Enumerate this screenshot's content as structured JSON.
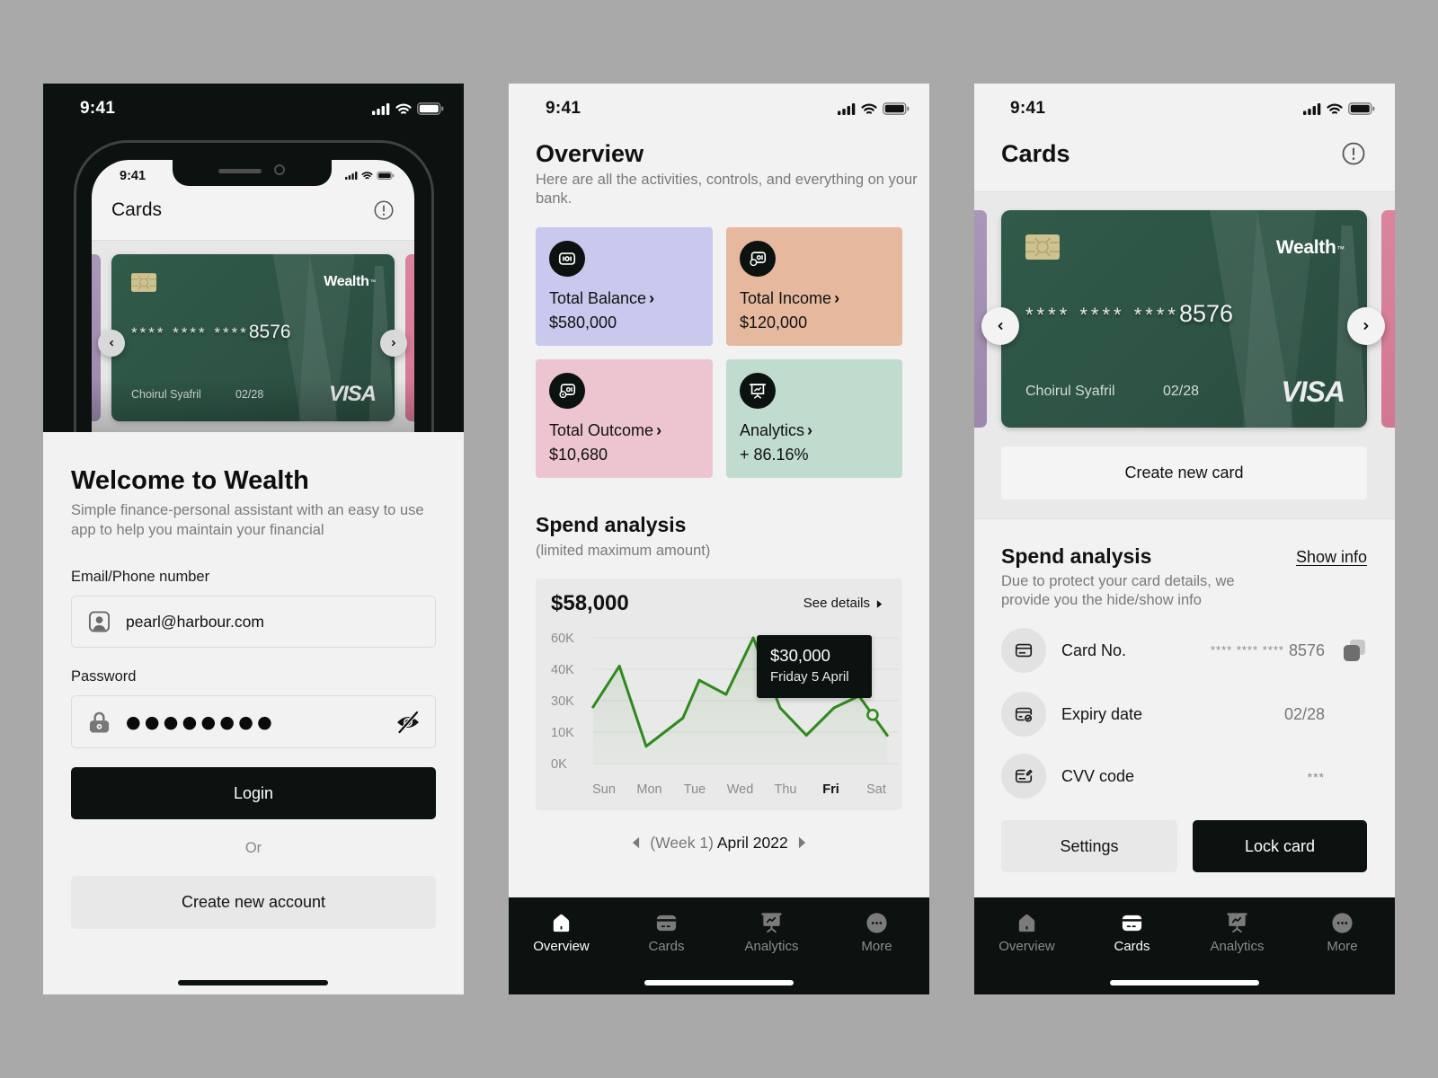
{
  "page": {
    "background": "#a9a9a9"
  },
  "theme": {
    "dark": "#0b120f",
    "card_green": "#2f5646",
    "chart_line": "#2f8a1c"
  },
  "login_screen": {
    "status_bar": {
      "time": "9:41"
    },
    "mockup": {
      "status_time": "9:41",
      "title": "Cards",
      "card": {
        "brand": "Wealth",
        "trademark": "™",
        "number_mask": "**** **** ****",
        "last4": "8576",
        "holder": "Choirul Syafril",
        "expiry": "02/28",
        "network": "VISA"
      }
    },
    "title": "Welcome to Wealth",
    "subtitle": "Simple finance-personal assistant with an easy to use app to help you maintain your financial",
    "email": {
      "label": "Email/Phone number",
      "value": "pearl@harbour.com"
    },
    "password": {
      "label": "Password",
      "masked_value": "●●●●●●●●"
    },
    "login_button": "Login",
    "divider_text": "Or",
    "create_account_button": "Create new account"
  },
  "overview_screen": {
    "status_bar": {
      "time": "9:41"
    },
    "title": "Overview",
    "subtitle": "Here are all the activities, controls, and everything on your bank.",
    "stat_chevron": "›",
    "stats": [
      {
        "label": "Total Balance",
        "value": "$580,000",
        "color": "#c9c8ee",
        "icon": "cash-icon"
      },
      {
        "label": "Total Income",
        "value": "$120,000",
        "color": "#e6b99f",
        "icon": "income-icon"
      },
      {
        "label": "Total Outcome",
        "value": "$10,680",
        "color": "#edc5d0",
        "icon": "outcome-icon"
      },
      {
        "label": "Analytics",
        "value": "+ 86.16%",
        "color": "#bfdccf",
        "icon": "presentation-chart-icon"
      }
    ],
    "spend": {
      "title": "Spend analysis",
      "subtitle": "(limited maximum amount)"
    },
    "week_selector": {
      "prefix": "(Week 1)",
      "label": "April 2022"
    },
    "bottom_nav": [
      {
        "label": "Overview",
        "active": true
      },
      {
        "label": "Cards",
        "active": false
      },
      {
        "label": "Analytics",
        "active": false
      },
      {
        "label": "More",
        "active": false
      }
    ]
  },
  "cards_screen": {
    "status_bar": {
      "time": "9:41"
    },
    "title": "Cards",
    "card": {
      "brand": "Wealth",
      "trademark": "™",
      "number_mask": "**** **** ****",
      "last4": "8576",
      "holder": "Choirul Syafril",
      "expiry": "02/28",
      "network": "VISA"
    },
    "create_card_button": "Create new card",
    "section_title": "Spend analysis",
    "show_info_link": "Show info",
    "section_desc": "Due to protect your card details, we provide you the hide/show info",
    "details": [
      {
        "label": "Card No.",
        "value_mask": "**** **** ****",
        "value_last4": "8576"
      },
      {
        "label": "Expiry date",
        "value": "02/28"
      },
      {
        "label": "CVV code",
        "value": "***"
      }
    ],
    "settings_button": "Settings",
    "lock_button": "Lock card",
    "bottom_nav": [
      {
        "label": "Overview",
        "active": false
      },
      {
        "label": "Cards",
        "active": true
      },
      {
        "label": "Analytics",
        "active": false
      },
      {
        "label": "More",
        "active": false
      }
    ]
  },
  "chart_data": {
    "type": "line",
    "title": "$58,000",
    "see_details_label": "See details",
    "xlabel": "",
    "ylabel": "",
    "categories": [
      "Sun",
      "Mon",
      "Tue",
      "Wed",
      "Thu",
      "Fri",
      "Sat"
    ],
    "highlighted_category": "Fri",
    "y_ticks": [
      0,
      10000,
      30000,
      40000,
      60000
    ],
    "y_tick_labels": [
      "0K",
      "10K",
      "30K",
      "40K",
      "60K"
    ],
    "ylim": [
      0,
      60000
    ],
    "grid": true,
    "legend": "none",
    "series": [
      {
        "name": "Spend",
        "color": "#2f8a1c",
        "x": [
          -0.24,
          0.34,
          0.93,
          1.74,
          2.1,
          2.69,
          3.29,
          3.88,
          4.46,
          5.07,
          5.62,
          6.24
        ],
        "values": [
          26000,
          42000,
          5500,
          19000,
          36500,
          32000,
          60000,
          25500,
          9000,
          25500,
          31500,
          9000
        ]
      }
    ],
    "highlight_point": {
      "x": 5.92,
      "value": 21000
    },
    "tooltip": {
      "value": "$30,000",
      "label": "Friday 5 April"
    }
  }
}
